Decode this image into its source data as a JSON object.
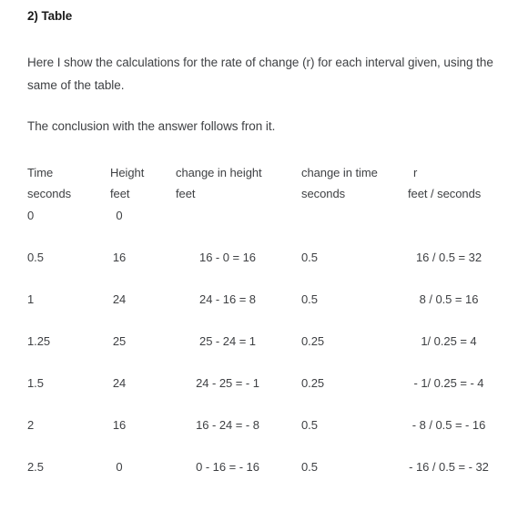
{
  "document": {
    "title": "2) Table",
    "paragraphs": [
      "Here I show the calculations for the rate of change (r) for each interval given, using the same of the table.",
      "The conclusion with the answer follows fron it."
    ]
  },
  "table": {
    "headers": [
      {
        "line1": "Time",
        "line2": "seconds"
      },
      {
        "line1": "Height",
        "line2": "feet"
      },
      {
        "line1": "change in height",
        "line2": "feet"
      },
      {
        "line1": "change in time",
        "line2": "seconds"
      },
      {
        "line1": "r",
        "line2": "feet / seconds"
      }
    ],
    "rows": [
      {
        "time": "0",
        "height": "0",
        "change_in_height": "",
        "change_in_time": "",
        "r": ""
      },
      {
        "time": "0.5",
        "height": "16",
        "change_in_height": "16 - 0 = 16",
        "change_in_time": "0.5",
        "r": "16 / 0.5 = 32"
      },
      {
        "time": "1",
        "height": "24",
        "change_in_height": "24 - 16 = 8",
        "change_in_time": "0.5",
        "r": "8 / 0.5 = 16"
      },
      {
        "time": "1.25",
        "height": "25",
        "change_in_height": "25 - 24 = 1",
        "change_in_time": "0.25",
        "r": "1/ 0.25 = 4"
      },
      {
        "time": "1.5",
        "height": "24",
        "change_in_height": "24 - 25 = - 1",
        "change_in_time": "0.25",
        "r": "- 1/ 0.25 = - 4"
      },
      {
        "time": "2",
        "height": "16",
        "change_in_height": "16 - 24 = - 8",
        "change_in_time": "0.5",
        "r": "- 8 / 0.5 = - 16"
      },
      {
        "time": "2.5",
        "height": "0",
        "change_in_height": "0 - 16 = - 16",
        "change_in_time": "0.5",
        "r": "- 16 / 0.5 = - 32"
      }
    ]
  },
  "colors": {
    "background": "#ffffff",
    "title_text": "#1b1b1b",
    "body_text": "#3f4144"
  }
}
